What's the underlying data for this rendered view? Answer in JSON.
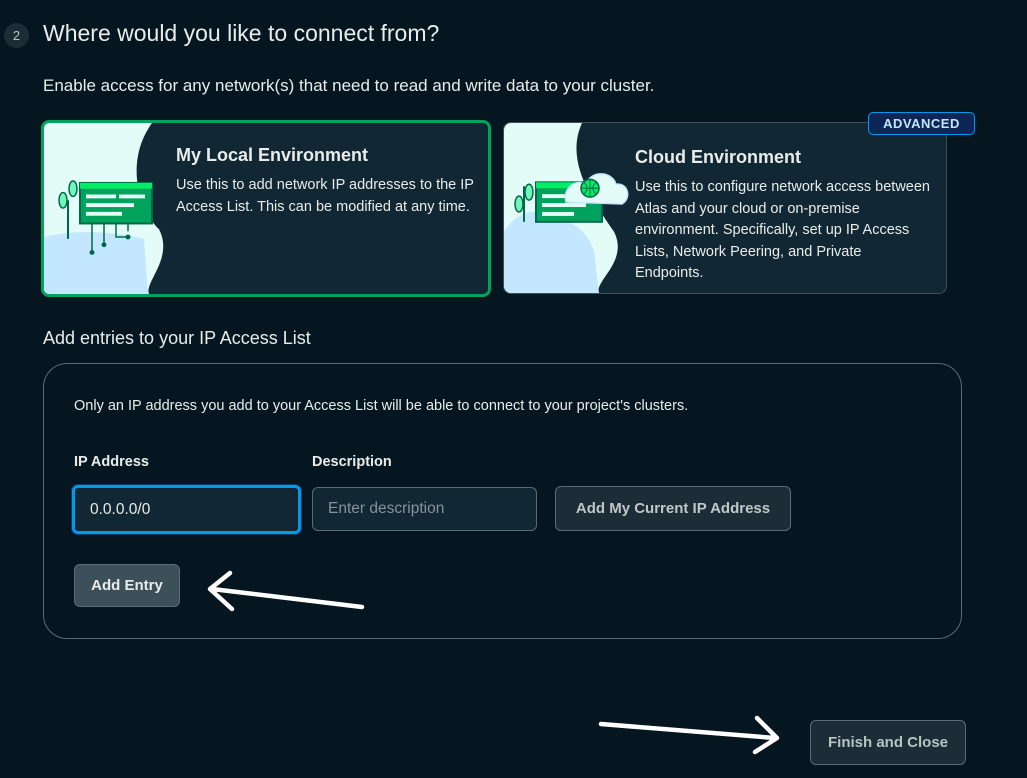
{
  "step": {
    "number": "2",
    "title": "Where would you like to connect from?"
  },
  "subtitle": "Enable access for any network(s) that need to read and write data to your cluster.",
  "environments": {
    "local": {
      "title": "My Local Environment",
      "description": "Use this to add network IP addresses to the IP Access List. This can be modified at any time.",
      "selected": true
    },
    "cloud": {
      "title": "Cloud Environment",
      "description": "Use this to configure network access between Atlas and your cloud or on-premise environment. Specifically, set up IP Access Lists, Network Peering, and Private Endpoints.",
      "badge": "ADVANCED"
    }
  },
  "access_list": {
    "heading": "Add entries to your IP Access List",
    "note": "Only an IP address you add to your Access List will be able to connect to your project's clusters.",
    "ip_label": "IP Address",
    "ip_value": "0.0.0.0/0",
    "description_label": "Description",
    "description_placeholder": "Enter description",
    "add_current_ip_label": "Add My Current IP Address",
    "add_entry_label": "Add Entry"
  },
  "footer": {
    "finish_label": "Finish and Close"
  },
  "colors": {
    "background": "#061621",
    "card": "#112733",
    "selected_border": "#00a35c",
    "focus_border": "#0498ec",
    "badge_bg": "#0c2657"
  },
  "icons": [
    "local-environment-illustration",
    "cloud-environment-illustration",
    "arrow-annotation"
  ]
}
